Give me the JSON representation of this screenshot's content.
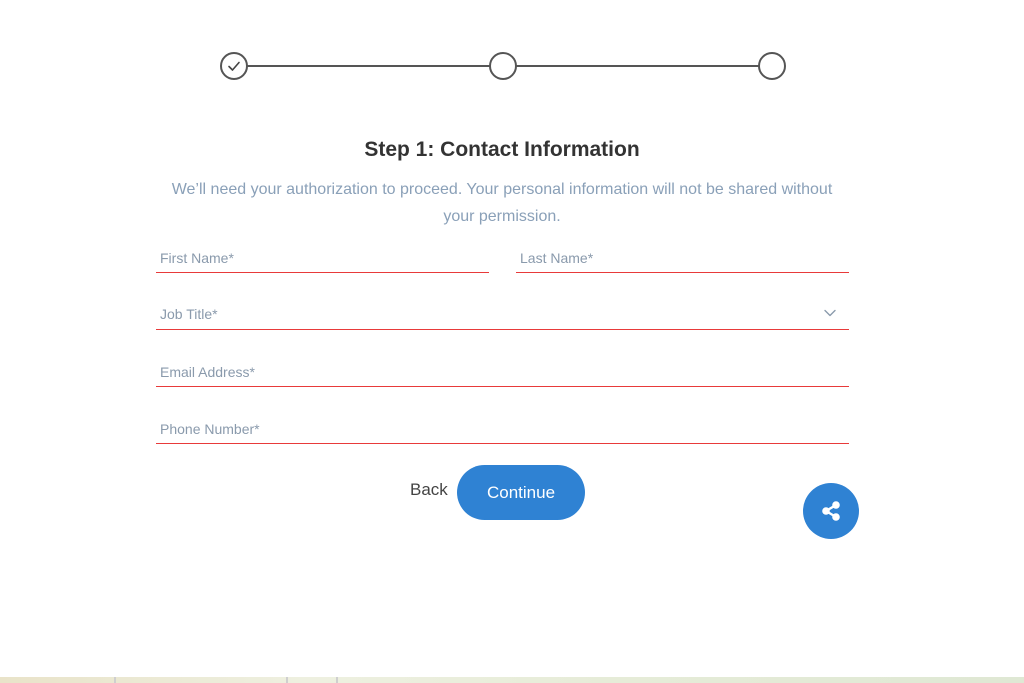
{
  "stepper": {
    "steps": [
      {
        "state": "completed",
        "icon": "check-icon"
      },
      {
        "state": "current",
        "icon": "circle-icon"
      },
      {
        "state": "pending",
        "icon": "circle-icon"
      }
    ]
  },
  "header": {
    "title": "Step 1: Contact Information",
    "subtitle": "We’ll need your authorization to proceed. Your personal information will not be shared without your permission."
  },
  "form": {
    "first_name": {
      "placeholder": "First Name*",
      "value": ""
    },
    "last_name": {
      "placeholder": "Last Name*",
      "value": ""
    },
    "job_title": {
      "placeholder": "Job Title*",
      "icon": "chevron-down-icon"
    },
    "email": {
      "placeholder": "Email Address*",
      "value": ""
    },
    "phone": {
      "placeholder": "Phone Number*",
      "value": ""
    }
  },
  "actions": {
    "back_label": "Back",
    "continue_label": "Continue",
    "share_icon": "share-icon"
  },
  "colors": {
    "accent": "#2f82d3",
    "error_underline": "#e83a3a",
    "subtitle": "#8aa0b8"
  }
}
